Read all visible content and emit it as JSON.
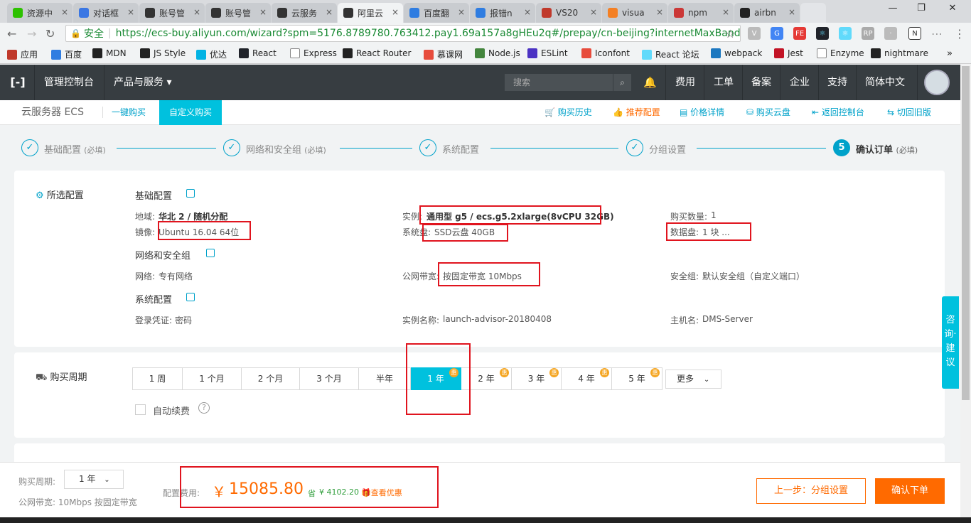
{
  "tabs": [
    {
      "label": "资源中",
      "icon": "wechat-icon",
      "color": "#2dc100"
    },
    {
      "label": "对话框",
      "icon": "blue-diamond-icon",
      "color": "#3b77e3"
    },
    {
      "label": "账号管",
      "icon": "aliyun-icon",
      "color": "#333333"
    },
    {
      "label": "账号管",
      "icon": "aliyun-icon",
      "color": "#333333"
    },
    {
      "label": "云服务",
      "icon": "aliyun-icon",
      "color": "#333333"
    },
    {
      "label": "阿里云",
      "icon": "aliyun-icon",
      "color": "#333333"
    },
    {
      "label": "百度翻",
      "icon": "baidu-translate-icon",
      "color": "#2f7de1"
    },
    {
      "label": "报错n",
      "icon": "baidu-paw-icon",
      "color": "#2f7de1"
    },
    {
      "label": "VS20",
      "icon": "house-icon",
      "color": "#c0392b"
    },
    {
      "label": "visua",
      "icon": "stackoverflow-icon",
      "color": "#f48024"
    },
    {
      "label": "npm",
      "icon": "npm-icon",
      "color": "#cb3837"
    },
    {
      "label": "airbn",
      "icon": "github-icon",
      "color": "#222222"
    }
  ],
  "addressbar": {
    "secure_label": "安全",
    "url": "https://ecs-buy.aliyun.com/wizard?spm=5176.8789780.763412.pay1.69a157a8gHEu2q#/prepay/cn-beijing?internetMaxBand..."
  },
  "bookmarks": [
    {
      "label": "应用",
      "icon": "apps-grid-icon",
      "color": "#c0392b"
    },
    {
      "label": "百度",
      "icon": "baidu-paw-icon",
      "color": "#2f7de1"
    },
    {
      "label": "MDN",
      "icon": "mdn-icon",
      "color": "#222222"
    },
    {
      "label": "JS Style",
      "icon": "github-icon",
      "color": "#222222"
    },
    {
      "label": "优达",
      "icon": "udacity-icon",
      "color": "#02b3e4"
    },
    {
      "label": "React",
      "icon": "react-icon",
      "color": "#20232a"
    },
    {
      "label": "Express",
      "icon": "page-icon",
      "color": "#ffffff"
    },
    {
      "label": "React Router",
      "icon": "react-router-icon",
      "color": "#222222"
    },
    {
      "label": "慕课网",
      "icon": "imooc-flame-icon",
      "color": "#e74c3c"
    },
    {
      "label": "Node.js",
      "icon": "nodejs-icon",
      "color": "#43853d"
    },
    {
      "label": "ESLint",
      "icon": "eslint-icon",
      "color": "#4b32c3"
    },
    {
      "label": "Iconfont",
      "icon": "iconfont-icon",
      "color": "#e74c3c"
    },
    {
      "label": "React 论坛",
      "icon": "react-icon",
      "color": "#61dafb"
    },
    {
      "label": "webpack",
      "icon": "webpack-icon",
      "color": "#1c78c0"
    },
    {
      "label": "Jest",
      "icon": "jest-icon",
      "color": "#c21325"
    },
    {
      "label": "Enzyme",
      "icon": "page-icon",
      "color": "#ffffff"
    },
    {
      "label": "nightmare",
      "icon": "github-icon",
      "color": "#222222"
    }
  ],
  "bookmarks_more": "»",
  "topnav": {
    "console": "管理控制台",
    "products": "产品与服务 ▾",
    "search_placeholder": "搜索",
    "fee": "费用",
    "ticket": "工单",
    "beian": "备案",
    "enterprise": "企业",
    "support": "支持",
    "lang": "简体中文"
  },
  "subnav": {
    "product": "云服务器 ECS",
    "quick_buy": "一键购买",
    "custom_buy": "自定义购买",
    "history": "购买历史",
    "recommend": "推荐配置",
    "price_detail": "价格详情",
    "buy_disk": "购买云盘",
    "back_console": "返回控制台",
    "old_version": "切回旧版"
  },
  "steps": [
    {
      "label": "基础配置",
      "note": "(必填)",
      "done": true
    },
    {
      "label": "网络和安全组",
      "note": "(必填)",
      "done": true
    },
    {
      "label": "系统配置",
      "note": "",
      "done": true
    },
    {
      "label": "分组设置",
      "note": "",
      "done": true
    },
    {
      "num": "5",
      "label": "确认订单",
      "note": "(必填)",
      "done": false
    }
  ],
  "selected": {
    "title": "所选配置",
    "basic_title": "基础配置",
    "region_label": "地域:",
    "region_value": "华北 2 / 随机分配",
    "instance_label": "实例:",
    "instance_value": "通用型 g5 / ecs.g5.2xlarge(8vCPU 32GB)",
    "qty_label": "购买数量:",
    "qty_value": "1",
    "image_label": "镜像:",
    "image_value": "Ubuntu 16.04 64位",
    "sysdisk_label": "系统盘:",
    "sysdisk_value": "SSD云盘 40GB",
    "datadisk_label": "数据盘:",
    "datadisk_value": "1 块 ...",
    "network_title": "网络和安全组",
    "net_label": "网络:",
    "net_value": "专有网络",
    "bw_label": "公网带宽:",
    "bw_value": "按固定带宽 10Mbps",
    "sg_label": "安全组:",
    "sg_value": "默认安全组（自定义端口）",
    "system_title": "系统配置",
    "login_label": "登录凭证:",
    "login_value": "密码",
    "inst_name_label": "实例名称:",
    "inst_name_value": "launch-advisor-20180408",
    "host_label": "主机名:",
    "host_value": "DMS-Server"
  },
  "period": {
    "title": "购买周期",
    "options": [
      "1 周",
      "1 个月",
      "2 个月",
      "3 个月",
      "半年",
      "1 年",
      "2 年",
      "3 年",
      "4 年",
      "5 年"
    ],
    "selected": "1 年",
    "discount_badge": "惠",
    "more": "更多",
    "auto_renew": "自动续费",
    "help": "?"
  },
  "side_float": "咨询·建议",
  "bottom": {
    "period_label": "购买周期:",
    "period_value": "1 年",
    "bw_text": "公网带宽: 10Mbps 按固定带宽",
    "fee_label": "配置费用:",
    "currency": "￥",
    "fee": "15085.80",
    "save_badge": "省",
    "save_value": "¥ 4102.20",
    "discount_link": "查看优惠",
    "prev": "上一步：分组设置",
    "confirm": "确认下单"
  },
  "accent": "#00c1de",
  "orange": "#ff6a00"
}
